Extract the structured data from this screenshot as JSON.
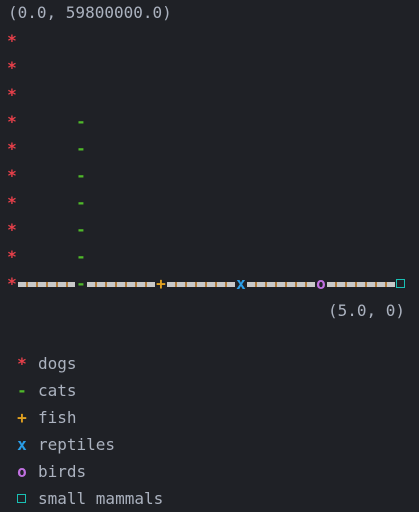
{
  "chart_data": {
    "type": "bar",
    "categories": [
      "dogs",
      "cats",
      "fish",
      "reptiles",
      "birds",
      "small mammals"
    ],
    "x": [
      0,
      1,
      2,
      3,
      4,
      5
    ],
    "values": [
      59800000,
      40000000,
      0,
      0,
      0,
      0
    ],
    "markers": [
      "*",
      "-",
      "+",
      "x",
      "o",
      "□"
    ],
    "colors": [
      "#e8404a",
      "#4fb82a",
      "#e0a020",
      "#2a9ee8",
      "#c070e0",
      "#19c0b4"
    ],
    "top_left_label": "(0.0, 59800000.0)",
    "bottom_right_label": "(5.0, 0)",
    "xlim": [
      0,
      5
    ],
    "ylim": [
      0,
      59800000
    ],
    "grid": false,
    "legend": "bottom-left"
  }
}
